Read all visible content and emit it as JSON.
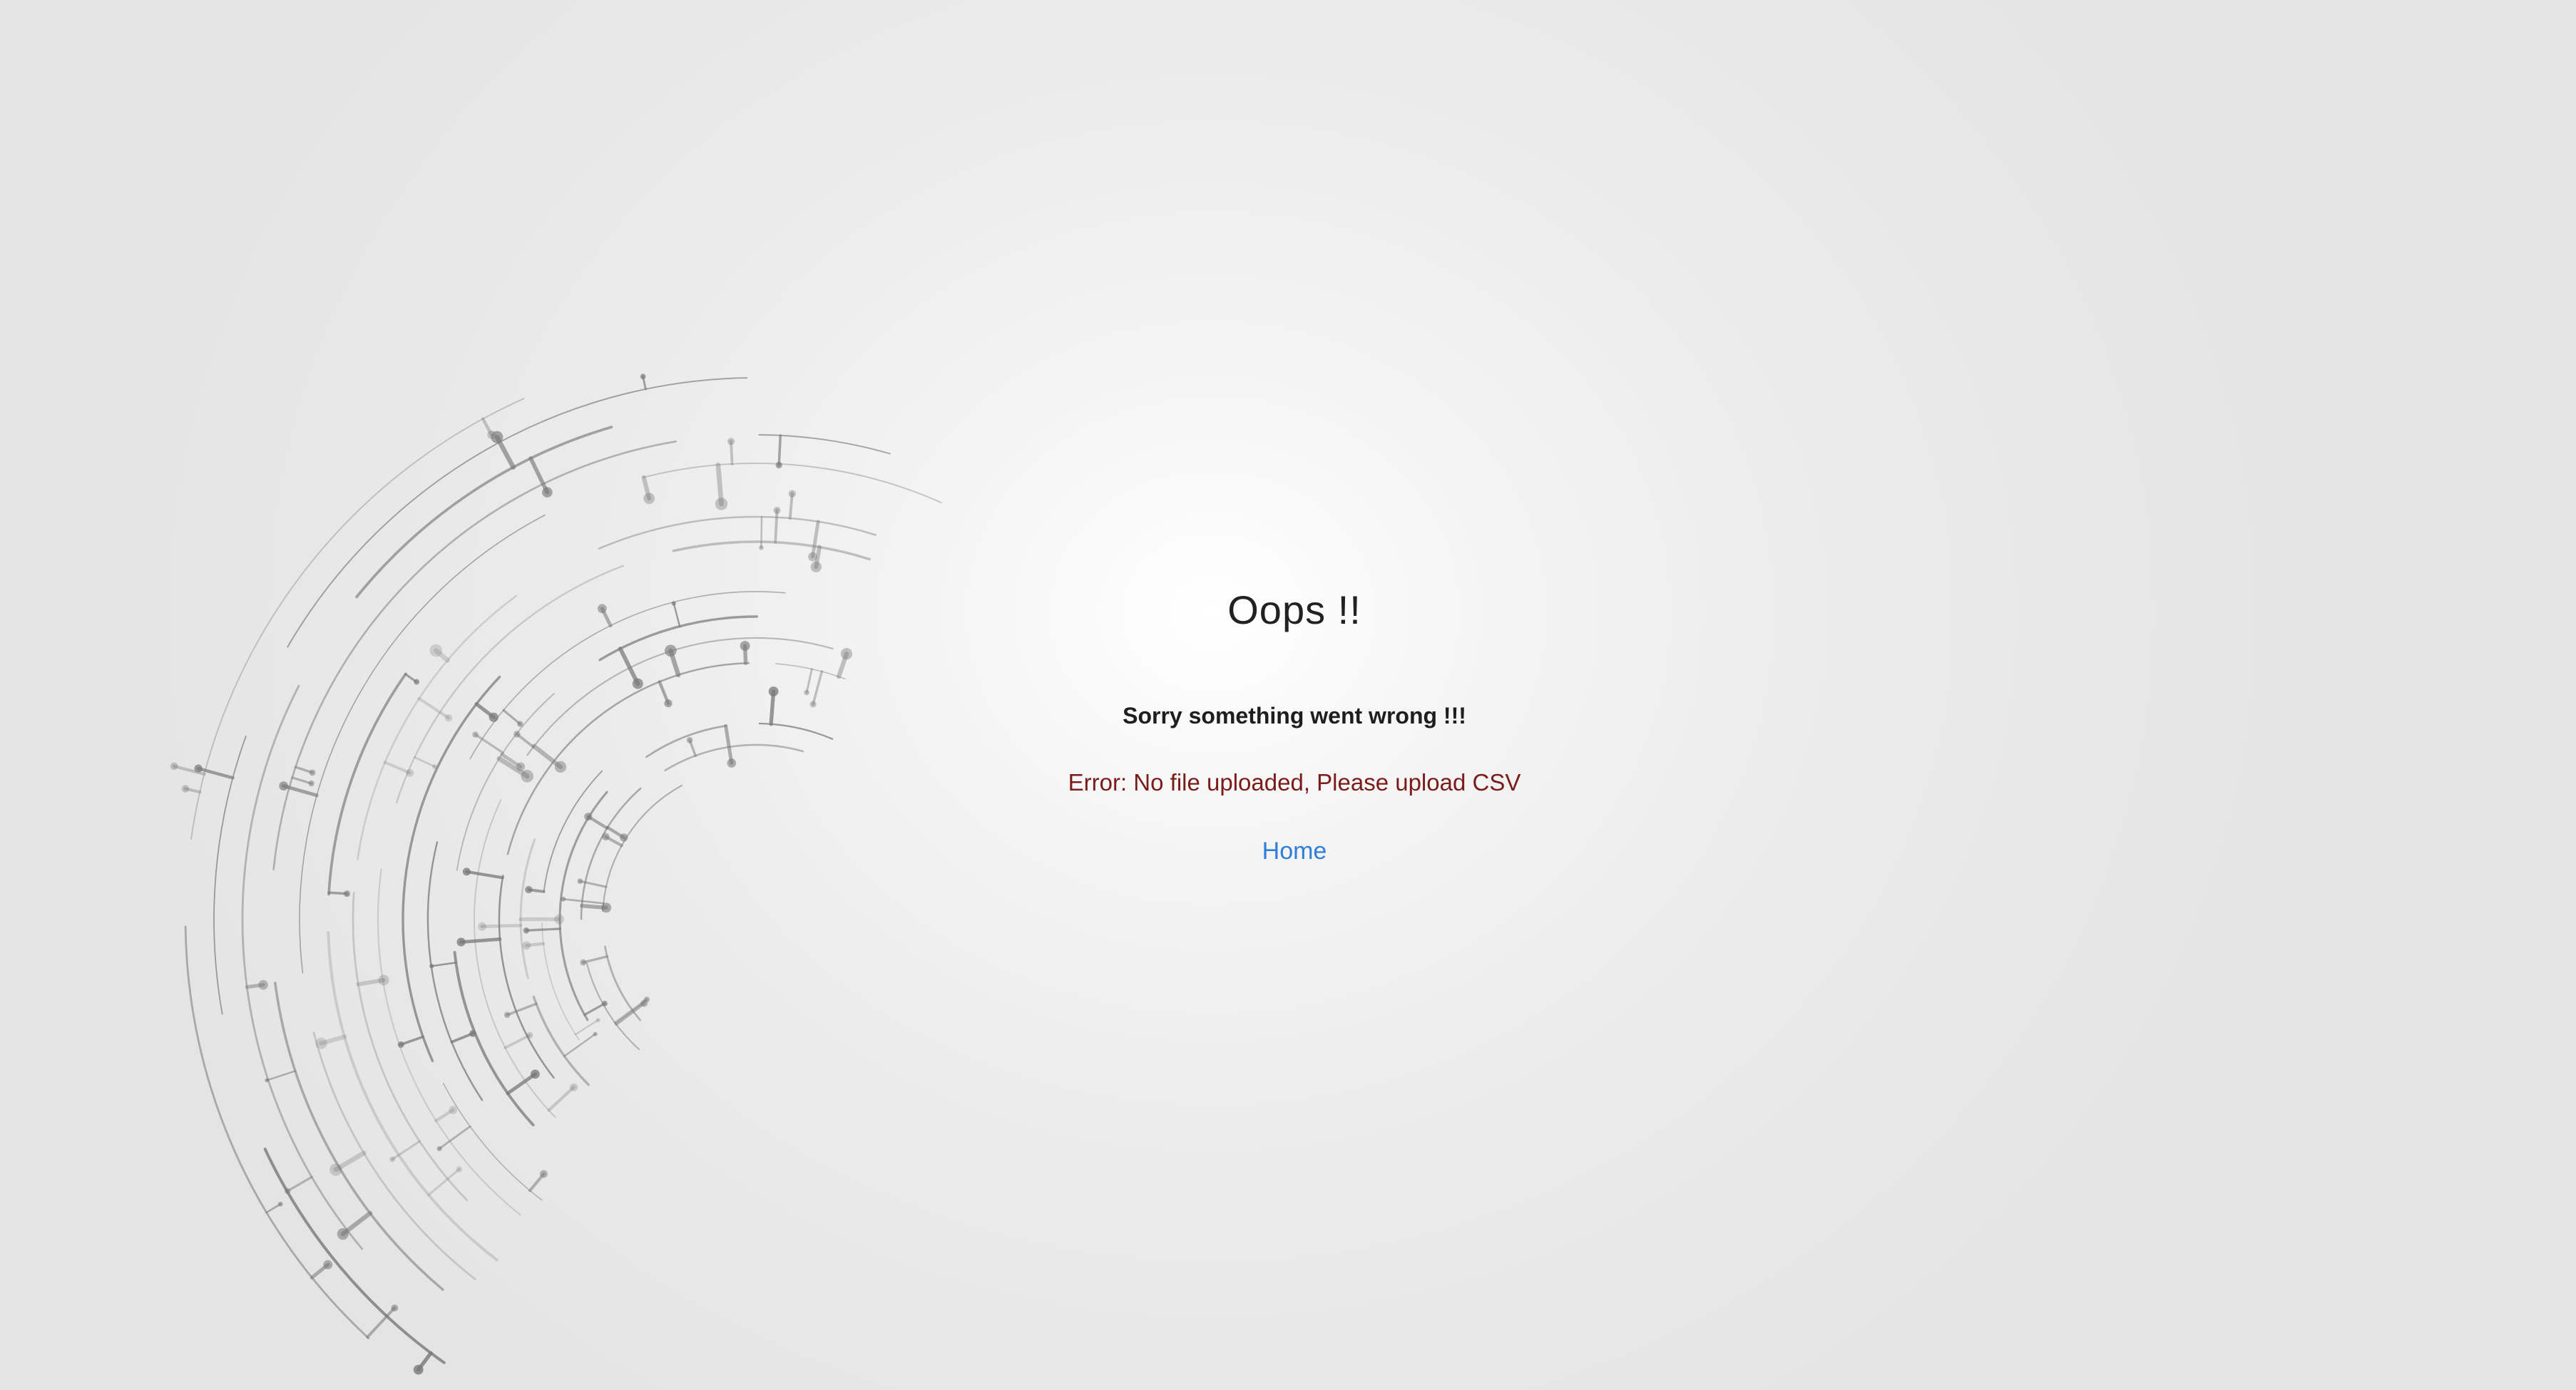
{
  "page": {
    "title": "Oops !!",
    "message": "Sorry something went wrong !!!",
    "error": "Error: No file uploaded, Please upload CSV",
    "home_link": "Home"
  },
  "colors": {
    "background": "#ebebeb",
    "title": "#212121",
    "error": "#7a1c1a",
    "link": "#2f7ed8",
    "decoration": "#777777"
  },
  "decoration": {
    "icon": "circuit-arc-decoration"
  }
}
